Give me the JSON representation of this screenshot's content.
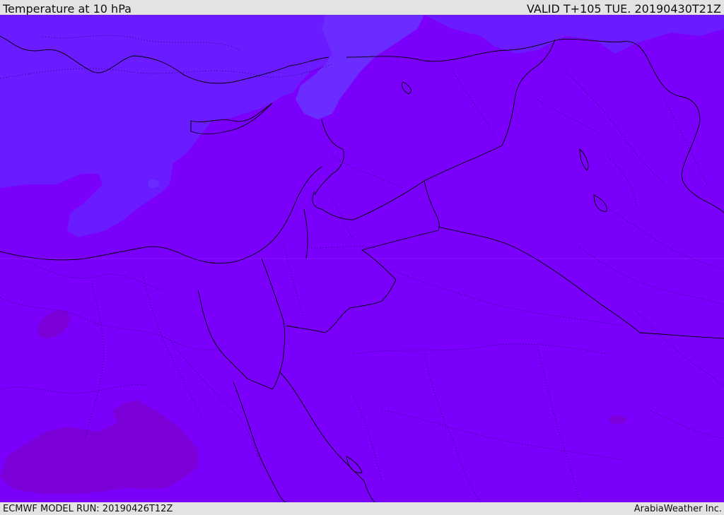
{
  "header": {
    "title": "Temperature at 10 hPa",
    "valid_time": "VALID T+105 TUE. 20190430T21Z"
  },
  "footer": {
    "model_run": "ECMWF MODEL RUN: 20190426T12Z",
    "credit": "ArabiaWeather Inc."
  },
  "map": {
    "field": "temperature",
    "level": "10 hPa",
    "colors": {
      "background_field": "#7b00fb",
      "cooler_region": "#6a1bff",
      "cooler_region_deep": "#6a2cff",
      "warmer_region": "#7c00d8",
      "coastline": "#000000",
      "boundary_dotted": "#1a0060"
    }
  }
}
